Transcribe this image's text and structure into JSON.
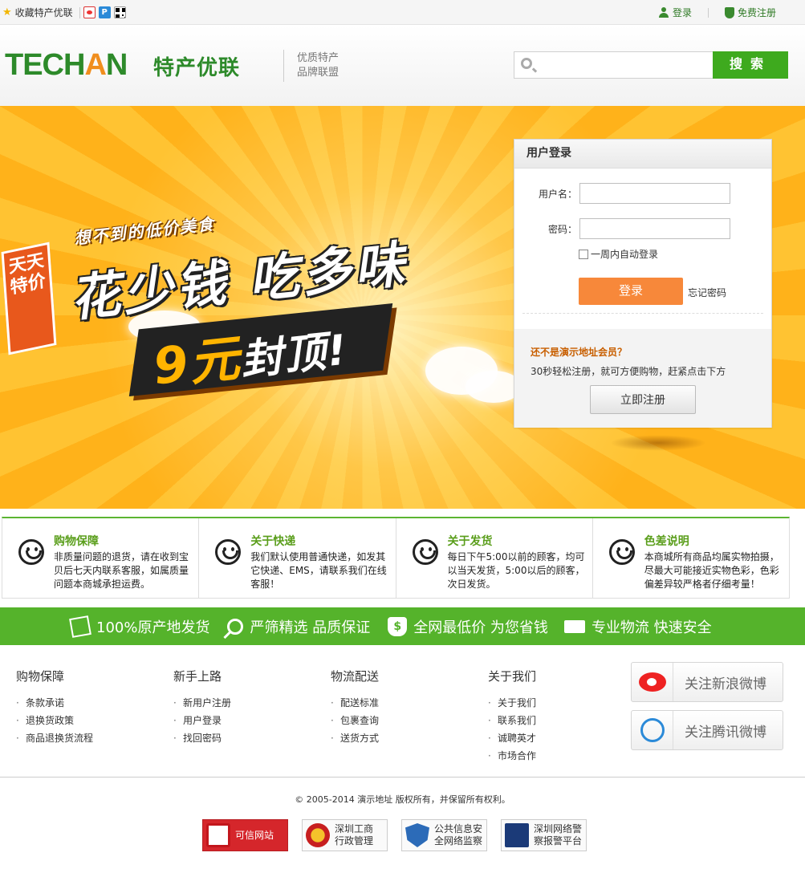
{
  "topbar": {
    "fav_label": "收藏特产优联",
    "login_label": "登录",
    "register_label": "免费注册"
  },
  "header": {
    "logo_en_1": "TECH",
    "logo_en_2": "A",
    "logo_en_3": "N",
    "logo_cn": "特产优联",
    "slogan_1": "优质特产",
    "slogan_2": "品牌联盟",
    "search_placeholder": "",
    "search_button": "搜索"
  },
  "banner": {
    "tag_lines": [
      "天天",
      "特价"
    ],
    "subtitle": "想不到的低价美食",
    "headline": "花少钱 吃多味",
    "price_num": "9元",
    "price_suffix": "封顶!"
  },
  "login": {
    "title": "用户登录",
    "username_label": "用户名：",
    "username_value": "",
    "password_label": "密码：",
    "password_value": "",
    "remember_label": "一周内自动登录",
    "login_button": "登录",
    "forgot_link": "忘记密码",
    "reg_question": "还不是演示地址会员？",
    "reg_desc": "30秒轻松注册，就可方便购物，赶紧点击下方",
    "reg_button": "立即注册"
  },
  "features": [
    {
      "title": "购物保障",
      "text": "非质量问题的退货，请在收到宝贝后七天内联系客服，如属质量问题本商城承担运费。"
    },
    {
      "title": "关于快递",
      "text": "我们默认使用普通快递，如发其它快递、EMS，请联系我们在线客服！"
    },
    {
      "title": "关于发货",
      "text": "每日下午5:00以前的顾客，均可以当天发货，5:00以后的顾客，次日发货。"
    },
    {
      "title": "色差说明",
      "text": "本商城所有商品均属实物拍摄，尽最大可能接近实物色彩，色彩偏差异较严格者仔细考量！"
    }
  ],
  "strip": [
    {
      "icon": "box-icon",
      "label": "100%原产地发货"
    },
    {
      "icon": "magnifier-icon",
      "label": "严筛精选 品质保证"
    },
    {
      "icon": "money-bag-icon",
      "label": "全网最低价 为您省钱"
    },
    {
      "icon": "truck-icon",
      "label": "专业物流 快速安全"
    }
  ],
  "footer": {
    "columns": [
      {
        "title": "购物保障",
        "items": [
          "条款承诺",
          "退换货政策",
          "商品退换货流程"
        ]
      },
      {
        "title": "新手上路",
        "items": [
          "新用户注册",
          "用户登录",
          "找回密码"
        ]
      },
      {
        "title": "物流配送",
        "items": [
          "配送标准",
          "包裹查询",
          "送货方式"
        ]
      },
      {
        "title": "关于我们",
        "items": [
          "关于我们",
          "联系我们",
          "诚聘英才",
          "市场合作"
        ]
      }
    ],
    "weibo_sina": "关注新浪微博",
    "weibo_tencent": "关注腾讯微博",
    "copyright": "© 2005-2014 演示地址 版权所有，并保留所有权利。",
    "badges": [
      {
        "line1": "可信网站",
        "line2": ""
      },
      {
        "line1": "深圳工商",
        "line2": "行政管理"
      },
      {
        "line1": "公共信息安",
        "line2": "全网络监察"
      },
      {
        "line1": "深圳网络警",
        "line2": "察报警平台"
      }
    ]
  },
  "colors": {
    "brand_green": "#2d8a2a",
    "strip_green": "#55b32b",
    "login_orange": "#f7883a",
    "banner_orange": "#ffb21a"
  }
}
